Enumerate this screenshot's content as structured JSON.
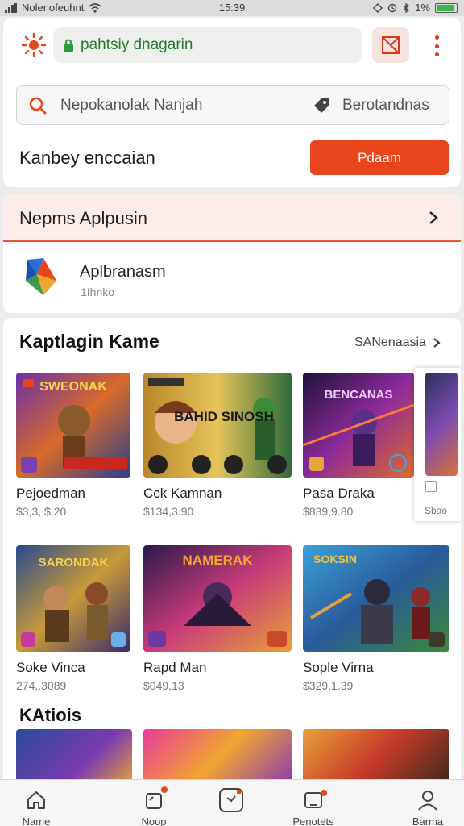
{
  "status_bar": {
    "carrier": "Nolenofeuhnt",
    "time": "15:39",
    "battery": "1%"
  },
  "browser": {
    "url": "pahtsiy dnagarin"
  },
  "search": {
    "placeholder": "Nepokanolak Nanjah",
    "right_label": "Berotandnas"
  },
  "promo": {
    "text": "Kanbey enccaian",
    "button": "Pdaam"
  },
  "section_apps": {
    "title": "Nepms Aplpusin",
    "app": {
      "title": "Aplbranasm",
      "subtitle": "1Ihnko"
    }
  },
  "section_games": {
    "title": "Kaptlagin Kame",
    "see_all": "SANenaasia",
    "games": [
      {
        "name": "Pejoedman",
        "price": "$3,3, $.20",
        "banner": "SWEONAK"
      },
      {
        "name": "Cck Kamnan",
        "price": "$134,3.90",
        "banner": "BAHID SINOSH"
      },
      {
        "name": "Pasa Draka",
        "price": "$839,9.80",
        "banner": "BENCANAS"
      },
      {
        "name": "Soke Vinca",
        "price": "274,.3089",
        "banner": "SARONDAK"
      },
      {
        "name": "Rapd Man",
        "price": "$049,13",
        "banner": "NAMERAK"
      },
      {
        "name": "Sople Virna",
        "price": "$329,1.39",
        "banner": "SOKSIN"
      }
    ],
    "peek_subtitle": "Sbao"
  },
  "section_cats": {
    "title": "KAtiois"
  },
  "nav": [
    {
      "label": "Name",
      "icon": "home-icon"
    },
    {
      "label": "Noop",
      "icon": "notification-icon"
    },
    {
      "label": "",
      "icon": "apps-icon"
    },
    {
      "label": "Penotets",
      "icon": "downloads-icon"
    },
    {
      "label": "Barma",
      "icon": "profile-icon"
    }
  ],
  "colors": {
    "accent": "#e8451c",
    "url_green": "#1f7a2c",
    "header_tint": "#fdece8"
  }
}
